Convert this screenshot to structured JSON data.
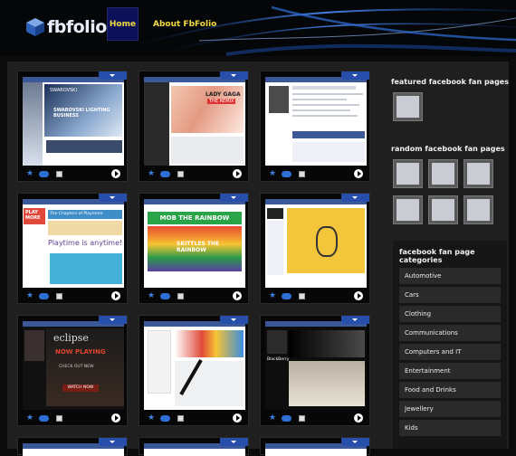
{
  "header": {
    "logo_text": "fbfolio",
    "nav": [
      {
        "label": "Home",
        "active": true
      },
      {
        "label": "About FbFolio",
        "active": false
      }
    ]
  },
  "sidebar": {
    "featured_title": "featured facebook fan pages",
    "random_title": "random facebook fan pages",
    "categories_title": "facebook fan page categories",
    "categories": [
      "Automotive",
      "Cars",
      "Clothing",
      "Communications",
      "Computers and IT",
      "Entertainment",
      "Food and Drinks",
      "Jewellery",
      "Kids"
    ]
  },
  "cards": [
    {
      "name": "swarovski",
      "texts": [
        "SWAROVSKI",
        "SWAROVSKI LIGHTING BUSINESS"
      ]
    },
    {
      "name": "lady-gaga",
      "texts": [
        "LADY GAGA",
        "THE REMIX"
      ]
    },
    {
      "name": "fan-page-3",
      "texts": []
    },
    {
      "name": "playmore",
      "texts": [
        "PLAY MORE",
        "The Chapters of Playmore",
        "Playtime is anytime!"
      ]
    },
    {
      "name": "skittles",
      "texts": [
        "MOB THE RAINBOW",
        "SKITTLES THE RAINBOW"
      ]
    },
    {
      "name": "fan-page-6",
      "texts": []
    },
    {
      "name": "eclipse",
      "texts": [
        "eclipse",
        "NOW PLAYING",
        "CHECK OUT NEW",
        "WATCH NOW"
      ]
    },
    {
      "name": "pen-page",
      "texts": []
    },
    {
      "name": "blackberry",
      "texts": [
        "BlackBerry"
      ]
    }
  ],
  "colors": {
    "nav_text": "#f2dc43",
    "nav_active_bg": "#0c1058",
    "accent_blue": "#274eaa"
  }
}
